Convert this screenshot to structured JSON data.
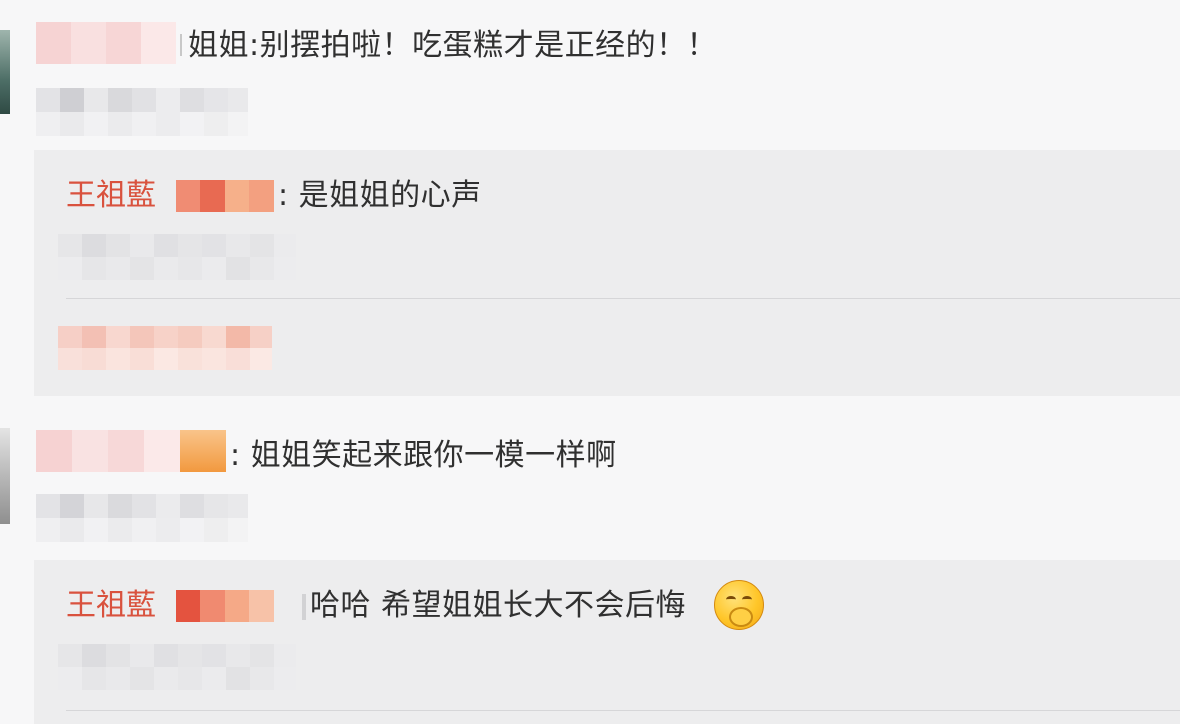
{
  "comments": [
    {
      "text": "姐姐:别摆拍啦！吃蛋糕才是正经的！！"
    },
    {
      "text": ": 姐姐笑起来跟你一模一样啊"
    }
  ],
  "replies": [
    {
      "author": "王祖藍",
      "text": ": 是姐姐的心声"
    },
    {
      "author": "王祖藍",
      "text": "哈哈 希望姐姐长大不会后悔"
    }
  ],
  "emoji": {
    "name": "shy-smile-emoji"
  },
  "colors": {
    "author": "#d9523e",
    "background": "#f7f7f8",
    "reply_background": "#ededee"
  }
}
